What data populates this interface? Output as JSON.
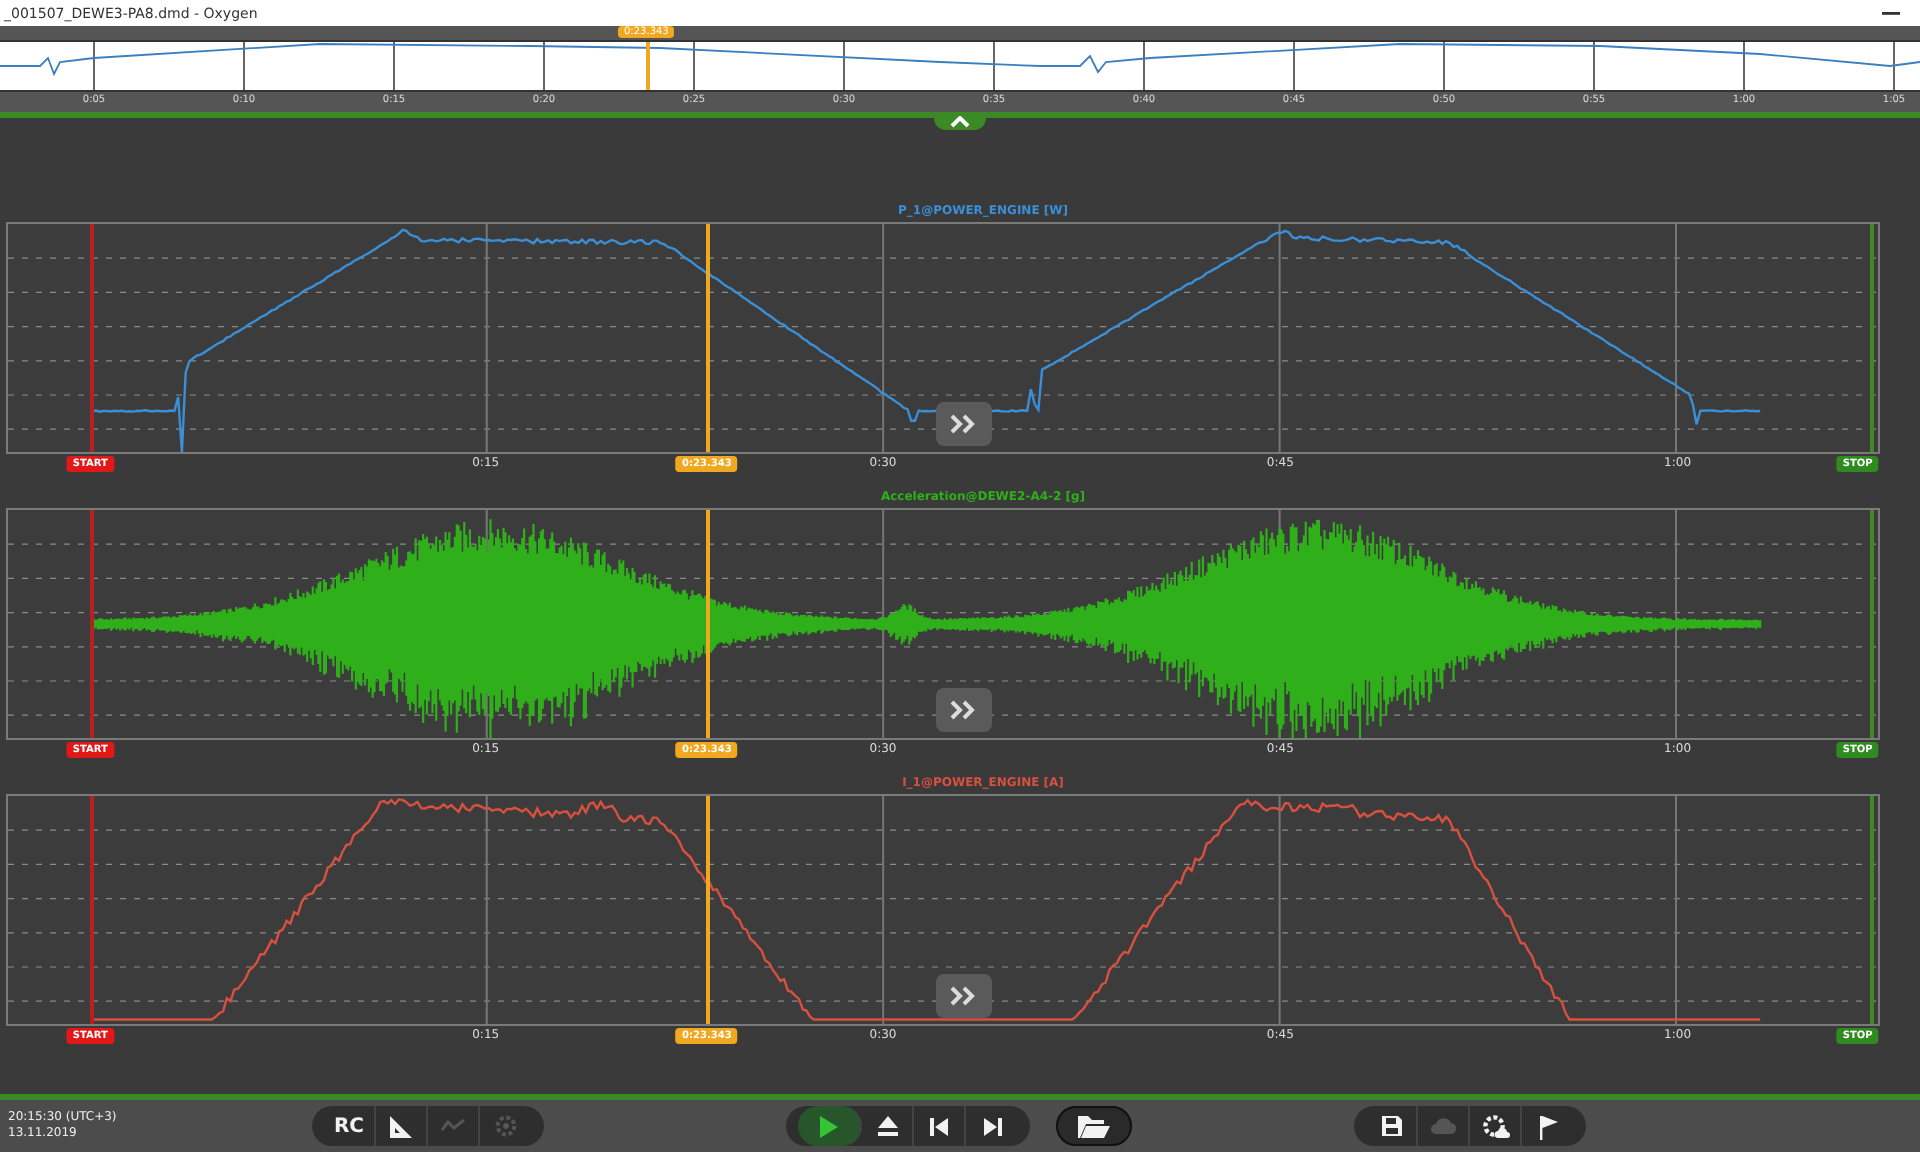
{
  "window": {
    "title": "_001507_DEWE3-PA8.dmd - Oxygen"
  },
  "overview": {
    "cursor_label": "0:23.343",
    "ticks": [
      "0:05",
      "0:10",
      "0:15",
      "0:20",
      "0:25",
      "0:30",
      "0:35",
      "0:40",
      "0:45",
      "0:50",
      "0:55",
      "1:00",
      "1:05"
    ],
    "expanded": false
  },
  "panels": [
    {
      "title": "P_1@POWER_ENGINE [W]",
      "kind": "power",
      "color": "#3a8fd6",
      "start_label": "START",
      "cursor_label": "0:23.343",
      "stop_label": "STOP",
      "ticks": [
        "0:15",
        "0:30",
        "0:45",
        "1:00"
      ]
    },
    {
      "title": "Acceleration@DEWE2-A4-2 [g]",
      "kind": "vibration",
      "color": "#2fb01a",
      "start_label": "START",
      "cursor_label": "0:23.343",
      "stop_label": "STOP",
      "ticks": [
        "0:15",
        "0:30",
        "0:45",
        "1:00"
      ]
    },
    {
      "title": "I_1@POWER_ENGINE [A]",
      "kind": "current",
      "color": "#d85040",
      "start_label": "START",
      "cursor_label": "0:23.343",
      "stop_label": "STOP",
      "ticks": [
        "0:15",
        "0:30",
        "0:45",
        "1:00"
      ]
    }
  ],
  "status": {
    "time": "20:15:30 (UTC+3)",
    "date": "13.11.2019"
  },
  "toolbar": [
    [
      {
        "label": "RC",
        "disabled": false
      },
      {
        "disabled": false
      },
      {
        "disabled": true
      },
      {
        "disabled": true
      }
    ],
    [
      {
        "disabled": false,
        "selected": true
      },
      {
        "disabled": false,
        "selected": false
      },
      {
        "disabled": false,
        "selected": false
      },
      {
        "disabled": false,
        "selected": false
      }
    ],
    [
      {
        "disabled": false
      }
    ],
    [
      {
        "disabled": false
      },
      {
        "disabled": true
      },
      {
        "disabled": false
      },
      {
        "disabled": false
      }
    ]
  ]
}
